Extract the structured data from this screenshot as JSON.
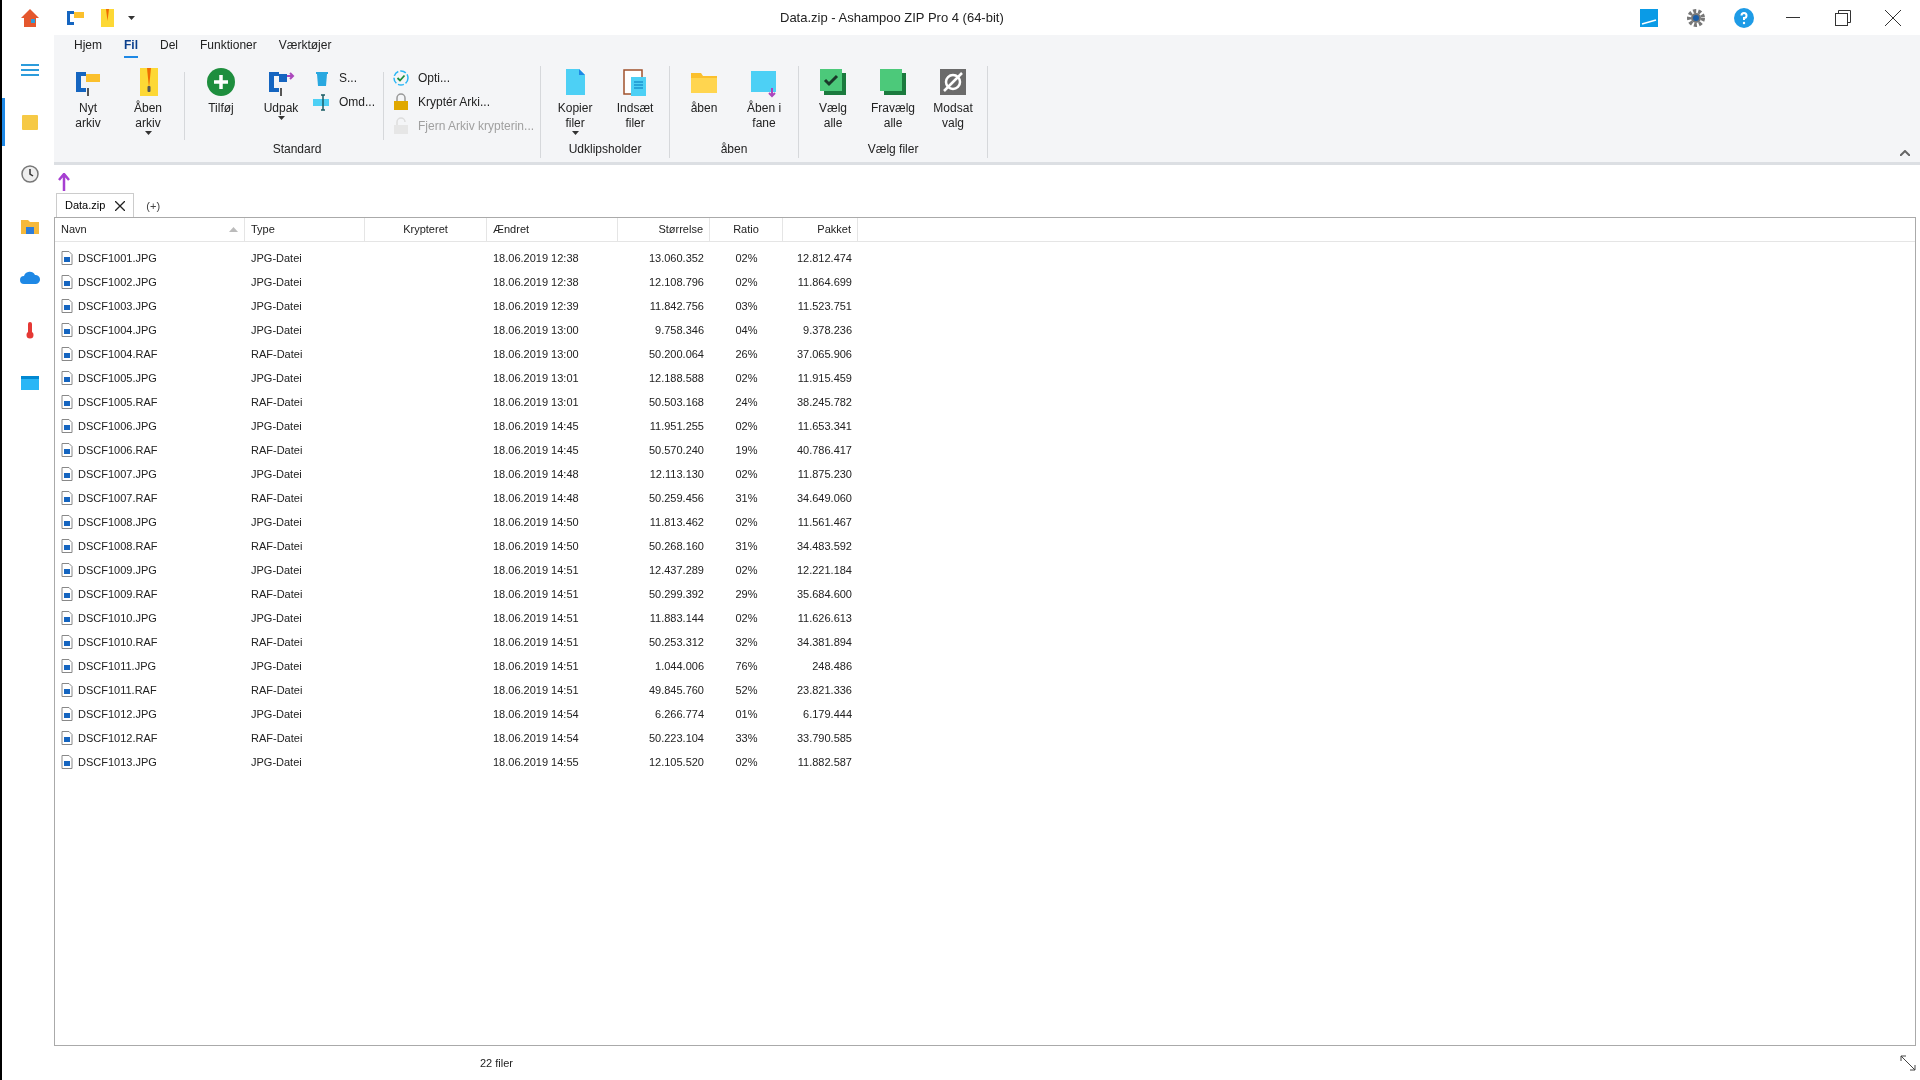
{
  "window": {
    "title": "Data.zip - Ashampoo ZIP Pro 4 (64-bit)"
  },
  "sidebar": {
    "items": [
      {
        "selected": false
      },
      {
        "selected": false
      },
      {
        "selected": true
      },
      {
        "selected": false
      },
      {
        "selected": false
      },
      {
        "selected": false
      },
      {
        "selected": false
      },
      {
        "selected": false
      }
    ]
  },
  "ribbon": {
    "tabs": [
      {
        "label": "Hjem",
        "selected": false
      },
      {
        "label": "Fil",
        "selected": true
      },
      {
        "label": "Del",
        "selected": false
      },
      {
        "label": "Funktioner",
        "selected": false
      },
      {
        "label": "Værktøjer",
        "selected": false
      }
    ],
    "groups": [
      {
        "title": "Standard",
        "items": [
          {
            "kind": "large",
            "label": "Nyt arkiv",
            "dropdown": false
          },
          {
            "kind": "large",
            "label": "Åben arkiv",
            "dropdown": true
          },
          {
            "kind": "separator"
          },
          {
            "kind": "large",
            "label": "Tilføj",
            "dropdown": false
          },
          {
            "kind": "large",
            "label": "Udpak",
            "dropdown": true
          },
          {
            "kind": "stack",
            "buttons": [
              {
                "label": "S...",
                "disabled": false
              },
              {
                "label": "Omd...",
                "disabled": false
              }
            ]
          },
          {
            "kind": "separator"
          },
          {
            "kind": "stack",
            "buttons": [
              {
                "label": "Opti...",
                "disabled": false
              },
              {
                "label": "Kryptér Arki...",
                "disabled": false
              },
              {
                "label": "Fjern Arkiv krypterin...",
                "disabled": true
              }
            ]
          }
        ]
      },
      {
        "title": "Udklipsholder",
        "items": [
          {
            "kind": "large",
            "label": "Kopier filer",
            "dropdown": true
          },
          {
            "kind": "large",
            "label": "Indsæt filer",
            "dropdown": false
          }
        ]
      },
      {
        "title": "åben",
        "items": [
          {
            "kind": "large",
            "label": "åben",
            "dropdown": false
          },
          {
            "kind": "large",
            "label": "Åben i fane",
            "dropdown": false
          }
        ]
      },
      {
        "title": "Vælg filer",
        "items": [
          {
            "kind": "large",
            "label": "Vælg alle",
            "dropdown": false
          },
          {
            "kind": "large",
            "label": "Fravælg alle",
            "dropdown": false
          },
          {
            "kind": "large",
            "label": "Modsat valg",
            "dropdown": false
          }
        ]
      }
    ]
  },
  "doc_tabs": [
    {
      "label": "Data.zip",
      "selected": true
    },
    {
      "label": "(+)",
      "selected": false
    }
  ],
  "table": {
    "columns": [
      {
        "label": "Navn",
        "sorted": true
      },
      {
        "label": "Type",
        "sorted": false
      },
      {
        "label": "Krypteret",
        "sorted": false
      },
      {
        "label": "Ændret",
        "sorted": false
      },
      {
        "label": "Størrelse",
        "sorted": false
      },
      {
        "label": "Ratio",
        "sorted": false
      },
      {
        "label": "Pakket",
        "sorted": false
      }
    ],
    "rows": [
      [
        "DSCF1001.JPG",
        "JPG-Datei",
        "",
        "18.06.2019 12:38",
        "13.060.352",
        "02%",
        "12.812.474"
      ],
      [
        "DSCF1002.JPG",
        "JPG-Datei",
        "",
        "18.06.2019 12:38",
        "12.108.796",
        "02%",
        "11.864.699"
      ],
      [
        "DSCF1003.JPG",
        "JPG-Datei",
        "",
        "18.06.2019 12:39",
        "11.842.756",
        "03%",
        "11.523.751"
      ],
      [
        "DSCF1004.JPG",
        "JPG-Datei",
        "",
        "18.06.2019 13:00",
        "9.758.346",
        "04%",
        "9.378.236"
      ],
      [
        "DSCF1004.RAF",
        "RAF-Datei",
        "",
        "18.06.2019 13:00",
        "50.200.064",
        "26%",
        "37.065.906"
      ],
      [
        "DSCF1005.JPG",
        "JPG-Datei",
        "",
        "18.06.2019 13:01",
        "12.188.588",
        "02%",
        "11.915.459"
      ],
      [
        "DSCF1005.RAF",
        "RAF-Datei",
        "",
        "18.06.2019 13:01",
        "50.503.168",
        "24%",
        "38.245.782"
      ],
      [
        "DSCF1006.JPG",
        "JPG-Datei",
        "",
        "18.06.2019 14:45",
        "11.951.255",
        "02%",
        "11.653.341"
      ],
      [
        "DSCF1006.RAF",
        "RAF-Datei",
        "",
        "18.06.2019 14:45",
        "50.570.240",
        "19%",
        "40.786.417"
      ],
      [
        "DSCF1007.JPG",
        "JPG-Datei",
        "",
        "18.06.2019 14:48",
        "12.113.130",
        "02%",
        "11.875.230"
      ],
      [
        "DSCF1007.RAF",
        "RAF-Datei",
        "",
        "18.06.2019 14:48",
        "50.259.456",
        "31%",
        "34.649.060"
      ],
      [
        "DSCF1008.JPG",
        "JPG-Datei",
        "",
        "18.06.2019 14:50",
        "11.813.462",
        "02%",
        "11.561.467"
      ],
      [
        "DSCF1008.RAF",
        "RAF-Datei",
        "",
        "18.06.2019 14:50",
        "50.268.160",
        "31%",
        "34.483.592"
      ],
      [
        "DSCF1009.JPG",
        "JPG-Datei",
        "",
        "18.06.2019 14:51",
        "12.437.289",
        "02%",
        "12.221.184"
      ],
      [
        "DSCF1009.RAF",
        "RAF-Datei",
        "",
        "18.06.2019 14:51",
        "50.299.392",
        "29%",
        "35.684.600"
      ],
      [
        "DSCF1010.JPG",
        "JPG-Datei",
        "",
        "18.06.2019 14:51",
        "11.883.144",
        "02%",
        "11.626.613"
      ],
      [
        "DSCF1010.RAF",
        "RAF-Datei",
        "",
        "18.06.2019 14:51",
        "50.253.312",
        "32%",
        "34.381.894"
      ],
      [
        "DSCF1011.JPG",
        "JPG-Datei",
        "",
        "18.06.2019 14:51",
        "1.044.006",
        "76%",
        "248.486"
      ],
      [
        "DSCF1011.RAF",
        "RAF-Datei",
        "",
        "18.06.2019 14:51",
        "49.845.760",
        "52%",
        "23.821.336"
      ],
      [
        "DSCF1012.JPG",
        "JPG-Datei",
        "",
        "18.06.2019 14:54",
        "6.266.774",
        "01%",
        "6.179.444"
      ],
      [
        "DSCF1012.RAF",
        "RAF-Datei",
        "",
        "18.06.2019 14:54",
        "50.223.104",
        "33%",
        "33.790.585"
      ],
      [
        "DSCF1013.JPG",
        "JPG-Datei",
        "",
        "18.06.2019 14:55",
        "12.105.520",
        "02%",
        "11.882.587"
      ]
    ]
  },
  "status_bar": {
    "text": "22 filer"
  }
}
